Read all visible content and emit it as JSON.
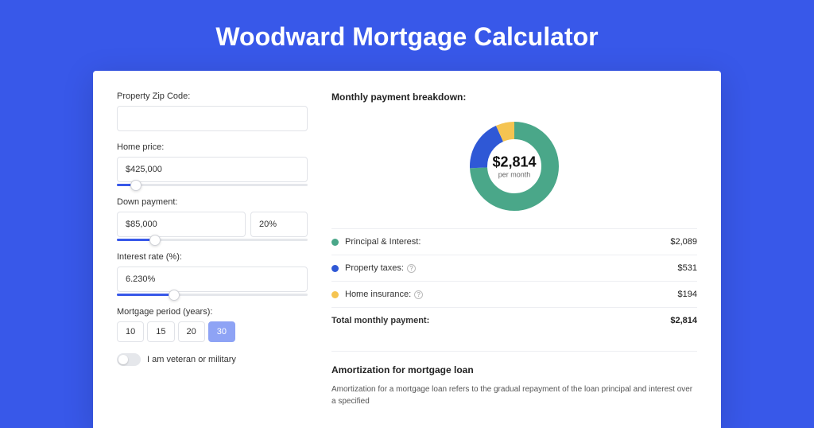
{
  "page_title": "Woodward Mortgage Calculator",
  "form": {
    "zip_label": "Property Zip Code:",
    "zip_value": "",
    "home_price_label": "Home price:",
    "home_price_value": "$425,000",
    "home_price_slider_pct": 10,
    "down_payment_label": "Down payment:",
    "down_payment_value": "$85,000",
    "down_payment_pct_value": "20%",
    "down_payment_slider_pct": 20,
    "interest_label": "Interest rate (%):",
    "interest_value": "6.230%",
    "interest_slider_pct": 30,
    "period_label": "Mortgage period (years):",
    "period_options": [
      "10",
      "15",
      "20",
      "30"
    ],
    "period_selected": "30",
    "veteran_label": "I am veteran or military",
    "veteran_on": false
  },
  "breakdown": {
    "title": "Monthly payment breakdown:",
    "center_value": "$2,814",
    "center_sub": "per month",
    "items": [
      {
        "label": "Principal & Interest:",
        "amount": "$2,089",
        "color": "#4aa789",
        "has_info": false
      },
      {
        "label": "Property taxes:",
        "amount": "$531",
        "color": "#2f58d6",
        "has_info": true
      },
      {
        "label": "Home insurance:",
        "amount": "$194",
        "color": "#f5c451",
        "has_info": true
      }
    ],
    "total_label": "Total monthly payment:",
    "total_amount": "$2,814"
  },
  "amort": {
    "title": "Amortization for mortgage loan",
    "text": "Amortization for a mortgage loan refers to the gradual repayment of the loan principal and interest over a specified"
  },
  "chart_data": {
    "type": "pie",
    "title": "Monthly payment breakdown",
    "series": [
      {
        "name": "Principal & Interest",
        "value": 2089,
        "color": "#4aa789"
      },
      {
        "name": "Property taxes",
        "value": 531,
        "color": "#2f58d6"
      },
      {
        "name": "Home insurance",
        "value": 194,
        "color": "#f5c451"
      }
    ],
    "total": 2814,
    "center_label": "$2,814 per month"
  }
}
